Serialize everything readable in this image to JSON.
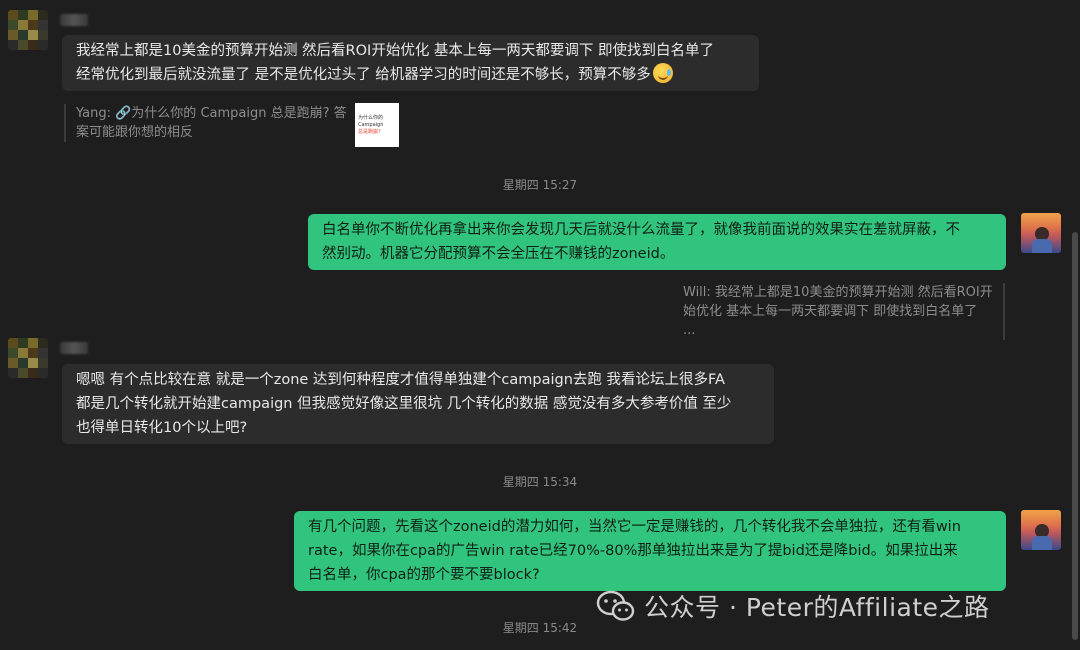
{
  "messages": [
    {
      "side": "left",
      "text_line1": "我经常上都是10美金的预算开始测 然后看ROI开始优化 基本上每一两天都要调下 即使找到白名单了",
      "text_line2": "经常优化到最后就没流量了  是不是优化过头了 给机器学习的时间还是不够长，预算不够多",
      "emoji": "crying-laughing-emoji",
      "quote_line1": "Yang: 🔗为什么你的 Campaign 总是跑崩? 答",
      "quote_line2": "案可能跟你想的相反",
      "thumb_line1": "为什么你的 Campaign",
      "thumb_line2": "总是跑崩?"
    },
    {
      "side": "right",
      "text_line1": "白名单你不断优化再拿出来你会发现几天后就没什么流量了，就像我前面说的效果实在差就屏蔽，不",
      "text_line2": "然别动。机器它分配预算不会全压在不赚钱的zoneid。",
      "quote_line1": "Will: 我经常上都是10美金的预算开始测 然后看ROI开",
      "quote_line2": "始优化 基本上每一两天都要调下 即使找到白名单了 ..."
    },
    {
      "side": "left",
      "text_line1": "嗯嗯  有个点比较在意 就是一个zone 达到何种程度才值得单独建个campaign去跑 我看论坛上很多FA",
      "text_line2": "都是几个转化就开始建campaign 但我感觉好像这里很坑 几个转化的数据 感觉没有多大参考价值 至少",
      "text_line3": "也得单日转化10个以上吧?"
    },
    {
      "side": "right",
      "text_line1": "有几个问题，先看这个zoneid的潜力如何，当然它一定是赚钱的，几个转化我不会单独拉，还有看win",
      "text_line2": "rate，如果你在cpa的广告win rate已经70%-80%那单独拉出来是为了提bid还是降bid。如果拉出来",
      "text_line3": "白名单，你cpa的那个要不要block?"
    }
  ],
  "timestamps": [
    "星期四 15:27",
    "星期四 15:34",
    "星期四 15:42"
  ],
  "watermark": {
    "icon": "wechat-icon",
    "text": "公众号 · Peter的Affiliate之路"
  },
  "colors": {
    "background": "#1e1e1e",
    "left_bubble": "#2c2c2c",
    "right_bubble": "#31c47e"
  }
}
